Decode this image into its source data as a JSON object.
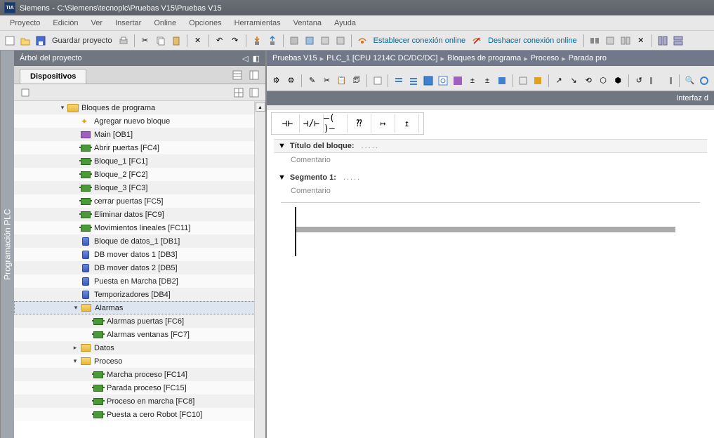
{
  "titlebar": {
    "app": "Siemens",
    "path": "C:\\Siemens\\tecnoplc\\Pruebas V15\\Pruebas V15"
  },
  "menu": [
    "Proyecto",
    "Edición",
    "Ver",
    "Insertar",
    "Online",
    "Opciones",
    "Herramientas",
    "Ventana",
    "Ayuda"
  ],
  "toolbar": {
    "save": "Guardar proyecto",
    "online": "Establecer conexión online",
    "offline": "Deshacer conexión online"
  },
  "sidebar_tab": "Programación PLC",
  "tree": {
    "title": "Árbol del proyecto",
    "tab": "Dispositivos",
    "items": [
      {
        "depth": 1,
        "exp": "▾",
        "icon": "folder",
        "label": "Bloques de programa"
      },
      {
        "depth": 2,
        "exp": "",
        "icon": "add",
        "label": "Agregar nuevo bloque"
      },
      {
        "depth": 2,
        "exp": "",
        "icon": "purple",
        "label": "Main [OB1]"
      },
      {
        "depth": 2,
        "exp": "",
        "icon": "green",
        "label": "Abrir puertas [FC4]"
      },
      {
        "depth": 2,
        "exp": "",
        "icon": "green",
        "label": "Bloque_1 [FC1]"
      },
      {
        "depth": 2,
        "exp": "",
        "icon": "green",
        "label": "Bloque_2 [FC2]"
      },
      {
        "depth": 2,
        "exp": "",
        "icon": "green",
        "label": "Bloque_3 [FC3]"
      },
      {
        "depth": 2,
        "exp": "",
        "icon": "green",
        "label": "cerrar puertas [FC5]"
      },
      {
        "depth": 2,
        "exp": "",
        "icon": "green",
        "label": "Eliminar datos [FC9]"
      },
      {
        "depth": 2,
        "exp": "",
        "icon": "green",
        "label": "Movimientos lineales [FC11]"
      },
      {
        "depth": 2,
        "exp": "",
        "icon": "db",
        "label": "Bloque de datos_1 [DB1]"
      },
      {
        "depth": 2,
        "exp": "",
        "icon": "db",
        "label": "DB mover datos 1 [DB3]"
      },
      {
        "depth": 2,
        "exp": "",
        "icon": "db",
        "label": "DB mover datos 2 [DB5]"
      },
      {
        "depth": 2,
        "exp": "",
        "icon": "db",
        "label": "Puesta en Marcha [DB2]"
      },
      {
        "depth": 2,
        "exp": "",
        "icon": "db",
        "label": "Temporizadores [DB4]"
      },
      {
        "depth": 2,
        "exp": "▾",
        "icon": "folder-sm",
        "label": "Alarmas",
        "selected": true
      },
      {
        "depth": 3,
        "exp": "",
        "icon": "green",
        "label": "Alarmas puertas [FC6]"
      },
      {
        "depth": 3,
        "exp": "",
        "icon": "green",
        "label": "Alarmas ventanas [FC7]"
      },
      {
        "depth": 2,
        "exp": "▸",
        "icon": "folder-sm",
        "label": "Datos"
      },
      {
        "depth": 2,
        "exp": "▾",
        "icon": "folder-sm",
        "label": "Proceso"
      },
      {
        "depth": 3,
        "exp": "",
        "icon": "green",
        "label": "Marcha proceso [FC14]"
      },
      {
        "depth": 3,
        "exp": "",
        "icon": "green",
        "label": "Parada proceso [FC15]"
      },
      {
        "depth": 3,
        "exp": "",
        "icon": "green",
        "label": "Proceso en marcha [FC8]"
      },
      {
        "depth": 3,
        "exp": "",
        "icon": "green",
        "label": "Puesta a cero Robot [FC10]"
      }
    ]
  },
  "breadcrumb": [
    "Pruebas V15",
    "PLC_1 [CPU 1214C DC/DC/DC]",
    "Bloques de programa",
    "Proceso",
    "Parada pro"
  ],
  "editor": {
    "interface": "Interfaz d",
    "lad_buttons": [
      "⊣⊢",
      "⊣/⊢",
      "–( )–",
      "⁇",
      "↦",
      "↥"
    ],
    "block_title_label": "Título del bloque:",
    "comment": "Comentario",
    "segment_label": "Segmento 1:",
    "segment_comment": "Comentario"
  }
}
